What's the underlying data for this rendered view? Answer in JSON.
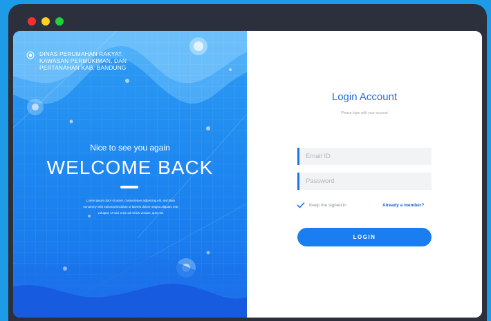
{
  "window": {
    "controls": [
      "close",
      "minimize",
      "maximize"
    ]
  },
  "left_panel": {
    "org_icon": "radio-target-icon",
    "org_name_lines": [
      "DINAS PERUMAHAN RAKYAT,",
      "KAWASAN PERMUKIMAN, DAN",
      "PERTANAHAN KAB. BANDUNG"
    ],
    "greeting": "Nice to see you again",
    "headline": "WELCOME BACK",
    "body_lines": [
      "Lorem ipsum dolor sit amet, consectetuer adipiscing elit, sed diam",
      "nonummy nibh euismod tincidunt ut laoreet dolore magna aliquam erat",
      "volutpat. Ut wisi enim ad minim veniam, quis nos"
    ]
  },
  "login": {
    "title": "Login Account",
    "subtitle": "Please login with your account",
    "email_placeholder": "Email ID",
    "password_placeholder": "Password",
    "remember_label": "Keep me signed in",
    "already_member": "Already a member?",
    "button_label": "LOGIN"
  },
  "colors": {
    "page_background": "#1e9be6",
    "frame": "#2c2f3c",
    "accent": "#1a7ef0",
    "title": "#1f6fd6"
  }
}
